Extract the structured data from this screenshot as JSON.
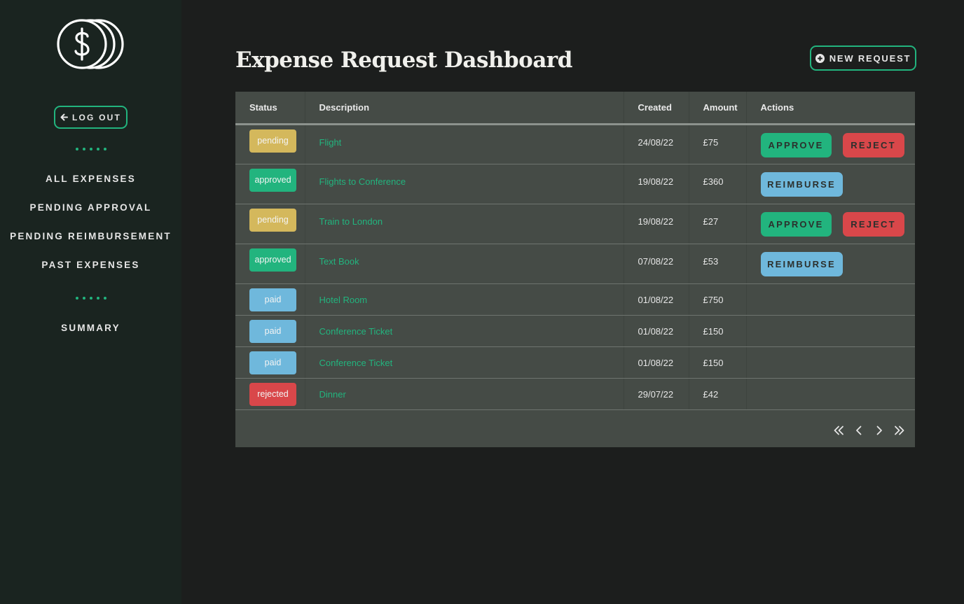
{
  "sidebar": {
    "logout_label": "LOG OUT",
    "nav": [
      "ALL EXPENSES",
      "PENDING APPROVAL",
      "PENDING REIMBURSEMENT",
      "PAST EXPENSES"
    ],
    "summary_label": "SUMMARY"
  },
  "header": {
    "title": "Expense Request Dashboard",
    "new_request_label": "NEW REQUEST"
  },
  "table": {
    "columns": [
      "Status",
      "Description",
      "Created",
      "Amount",
      "Actions"
    ],
    "rows": [
      {
        "status": "pending",
        "description": "Flight",
        "created": "24/08/22",
        "amount": "£75"
      },
      {
        "status": "approved",
        "description": "Flights to Conference",
        "created": "19/08/22",
        "amount": "£360"
      },
      {
        "status": "pending",
        "description": "Train to London",
        "created": "19/08/22",
        "amount": "£27"
      },
      {
        "status": "approved",
        "description": "Text Book",
        "created": "07/08/22",
        "amount": "£53"
      },
      {
        "status": "paid",
        "description": "Hotel Room",
        "created": "01/08/22",
        "amount": "£750"
      },
      {
        "status": "paid",
        "description": "Conference Ticket",
        "created": "01/08/22",
        "amount": "£150"
      },
      {
        "status": "paid",
        "description": "Conference Ticket",
        "created": "01/08/22",
        "amount": "£150"
      },
      {
        "status": "rejected",
        "description": "Dinner",
        "created": "29/07/22",
        "amount": "£42"
      }
    ],
    "actions": {
      "approve": "APPROVE",
      "reject": "REJECT",
      "reimburse": "REIMBURSE"
    }
  },
  "colors": {
    "accent": "#22b47e",
    "pending": "#d4b85c",
    "approved": "#22b47e",
    "paid": "#6fb8dc",
    "rejected": "#d9474a"
  },
  "icons": {
    "logo": "coins-dollar-icon",
    "logout": "arrow-left-icon",
    "new_request": "plus-circle-icon",
    "pager": [
      "chevrons-left-icon",
      "chevron-left-icon",
      "chevron-right-icon",
      "chevrons-right-icon"
    ]
  }
}
